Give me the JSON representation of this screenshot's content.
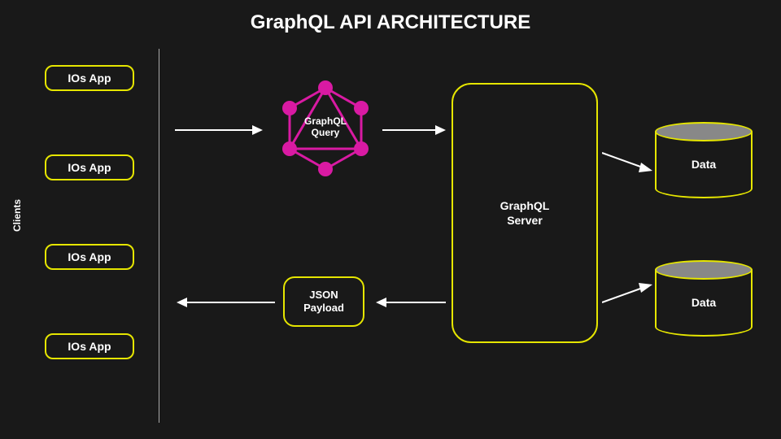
{
  "title": "GraphQL API ARCHITECTURE",
  "sidebar_label": "Clients",
  "clients": [
    {
      "label": "IOs App"
    },
    {
      "label": "IOs App"
    },
    {
      "label": "IOs App"
    },
    {
      "label": "IOs App"
    }
  ],
  "graphql_query": {
    "label": "GraphQL\nQuery"
  },
  "server": {
    "label": "GraphQL\nServer"
  },
  "json_payload": {
    "label": "JSON\nPayload"
  },
  "databases": [
    {
      "label": "Data"
    },
    {
      "label": "Data"
    }
  ],
  "colors": {
    "accent": "#e6e600",
    "graphql_pink": "#d91aa3",
    "bg": "#191919"
  }
}
